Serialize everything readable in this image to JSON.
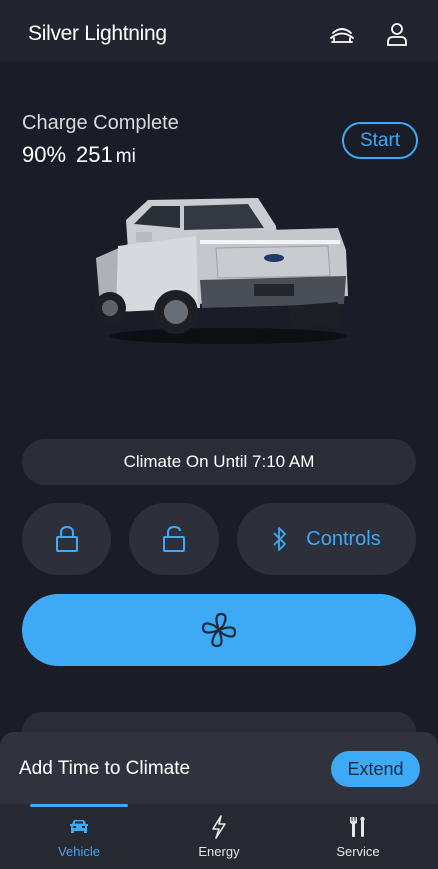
{
  "header": {
    "title": "Silver Lightning",
    "icons": [
      "garage-vehicles-icon",
      "account-icon"
    ]
  },
  "charge": {
    "status": "Charge Complete",
    "percent": "90%",
    "range": "251",
    "range_unit": "mi",
    "start_label": "Start"
  },
  "climate": {
    "status_text": "Climate On Until 7:10 AM"
  },
  "controls": {
    "lock_icon": "lock-icon",
    "unlock_icon": "unlock-icon",
    "bluetooth_icon": "bluetooth-icon",
    "controls_label": "Controls",
    "fan_icon": "fan-icon"
  },
  "sheet": {
    "title": "Add Time to Climate",
    "extend_label": "Extend"
  },
  "nav": {
    "items": [
      {
        "label": "Vehicle",
        "icon": "car-icon",
        "active": true
      },
      {
        "label": "Energy",
        "icon": "lightning-icon",
        "active": false
      },
      {
        "label": "Service",
        "icon": "tools-icon",
        "active": false
      }
    ]
  },
  "colors": {
    "background": "#1a1d27",
    "accent": "#3ea9f5",
    "surface": "#2d303a"
  }
}
